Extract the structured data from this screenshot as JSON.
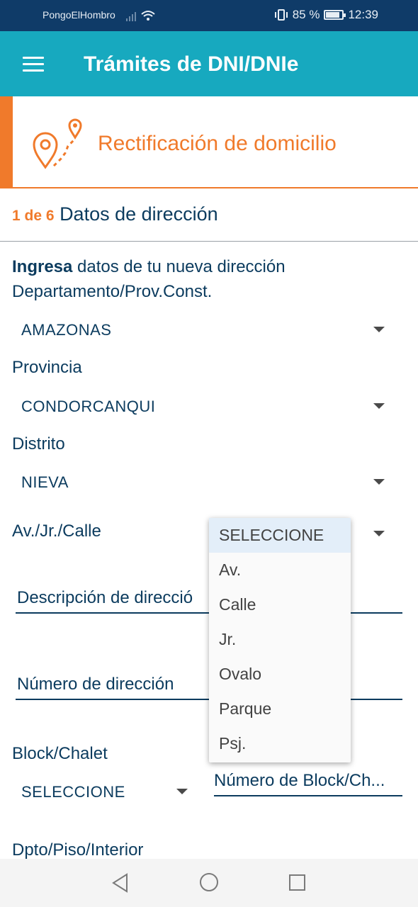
{
  "status_bar": {
    "carrier": "PongoElHombro",
    "battery": "85 %",
    "battery_level": 0.85,
    "time": "12:39"
  },
  "app_bar": {
    "title": "Trámites de DNI/DNIe",
    "menu_icon": "hamburger-menu-icon"
  },
  "header": {
    "icon": "map-pin-route-icon",
    "title": "Rectificación de domicilio",
    "accent_color": "#f07a2b"
  },
  "step": {
    "counter": "1 de 6",
    "title": "Datos de dirección"
  },
  "form": {
    "intro_bold": "Ingresa",
    "intro_rest": " datos de tu nueva dirección",
    "departamento": {
      "label": "Departamento/Prov.Const.",
      "value": "AMAZONAS"
    },
    "provincia": {
      "label": "Provincia",
      "value": "CONDORCANQUI"
    },
    "distrito": {
      "label": "Distrito",
      "value": "NIEVA"
    },
    "via": {
      "label": "Av./Jr./Calle"
    },
    "descripcion": {
      "placeholder": "Descripción de direcció"
    },
    "numero": {
      "placeholder": "Número de dirección"
    },
    "block": {
      "label": "Block/Chalet",
      "value": "SELECCIONE"
    },
    "numero_block": {
      "placeholder": "Número de Block/Ch..."
    },
    "dpto": {
      "label": "Dpto/Piso/Interior"
    }
  },
  "dropdown": {
    "options": [
      "SELECCIONE",
      "Av.",
      "Calle",
      "Jr.",
      "Ovalo",
      "Parque",
      "Psj."
    ],
    "selected": "SELECCIONE"
  },
  "colors": {
    "status_bar": "#0f3b68",
    "app_bar": "#17a9bf",
    "text": "#0b3b5e"
  }
}
